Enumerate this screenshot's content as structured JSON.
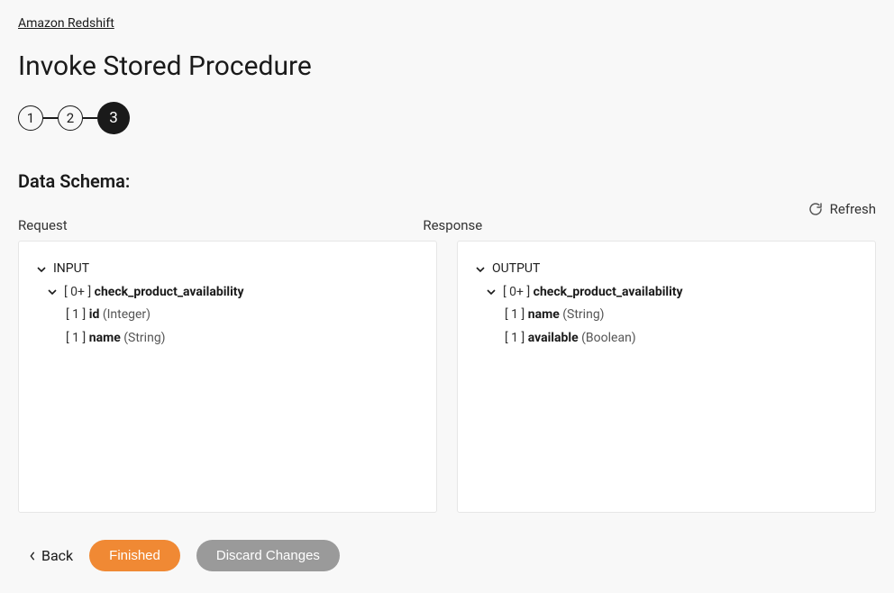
{
  "breadcrumb": {
    "label": "Amazon Redshift"
  },
  "page_title": "Invoke Stored Procedure",
  "stepper": {
    "steps": [
      "1",
      "2",
      "3"
    ],
    "active_index": 2
  },
  "section_title": "Data Schema:",
  "refresh_label": "Refresh",
  "request_label": "Request",
  "response_label": "Response",
  "request_tree": {
    "root_label": "INPUT",
    "item": {
      "count": "[ 0+ ]",
      "name": "check_product_availability",
      "fields": [
        {
          "count": "[ 1 ]",
          "name": "id",
          "type": "(Integer)"
        },
        {
          "count": "[ 1 ]",
          "name": "name",
          "type": "(String)"
        }
      ]
    }
  },
  "response_tree": {
    "root_label": "OUTPUT",
    "item": {
      "count": "[ 0+ ]",
      "name": "check_product_availability",
      "fields": [
        {
          "count": "[ 1 ]",
          "name": "name",
          "type": "(String)"
        },
        {
          "count": "[ 1 ]",
          "name": "available",
          "type": "(Boolean)"
        }
      ]
    }
  },
  "footer": {
    "back": "Back",
    "finished": "Finished",
    "discard": "Discard Changes"
  }
}
